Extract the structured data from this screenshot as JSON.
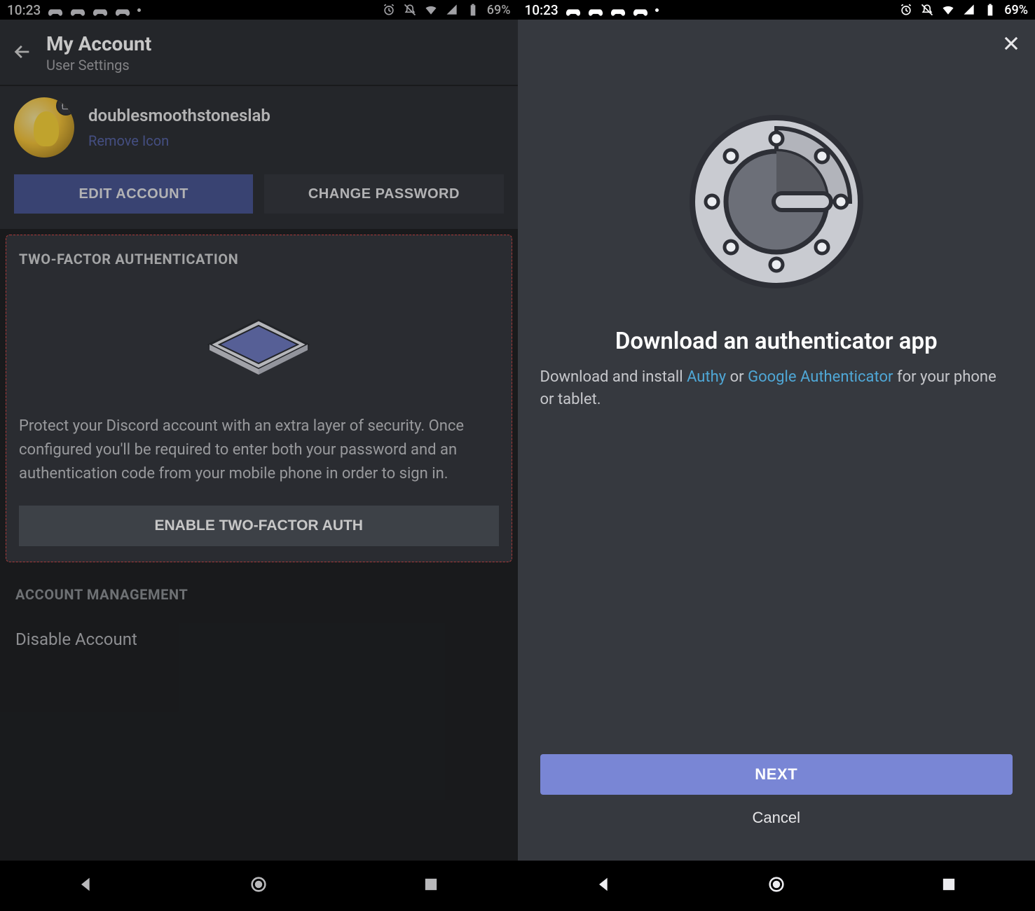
{
  "status": {
    "time": "10:23",
    "battery": "69%"
  },
  "left": {
    "header": {
      "title": "My Account",
      "subtitle": "User Settings"
    },
    "profile": {
      "username": "doublesmoothstoneslab",
      "remove_label": "Remove Icon",
      "edit_btn": "EDIT ACCOUNT",
      "change_pw_btn": "CHANGE PASSWORD"
    },
    "twofa": {
      "heading": "TWO-FACTOR AUTHENTICATION",
      "body": "Protect your Discord account with an extra layer of security. Once configured you'll be required to enter both your password and an authentication code from your mobile phone in order to sign in.",
      "enable_btn": "ENABLE TWO-FACTOR AUTH"
    },
    "acct": {
      "heading": "ACCOUNT MANAGEMENT",
      "disable_label": "Disable Account"
    }
  },
  "right": {
    "modal": {
      "title": "Download an authenticator app",
      "body_pre": "Download and install ",
      "link_authy": "Authy",
      "body_mid": " or ",
      "link_ga": "Google Authenticator",
      "body_post": " for your phone or tablet.",
      "next_btn": "NEXT",
      "cancel_btn": "Cancel"
    }
  }
}
